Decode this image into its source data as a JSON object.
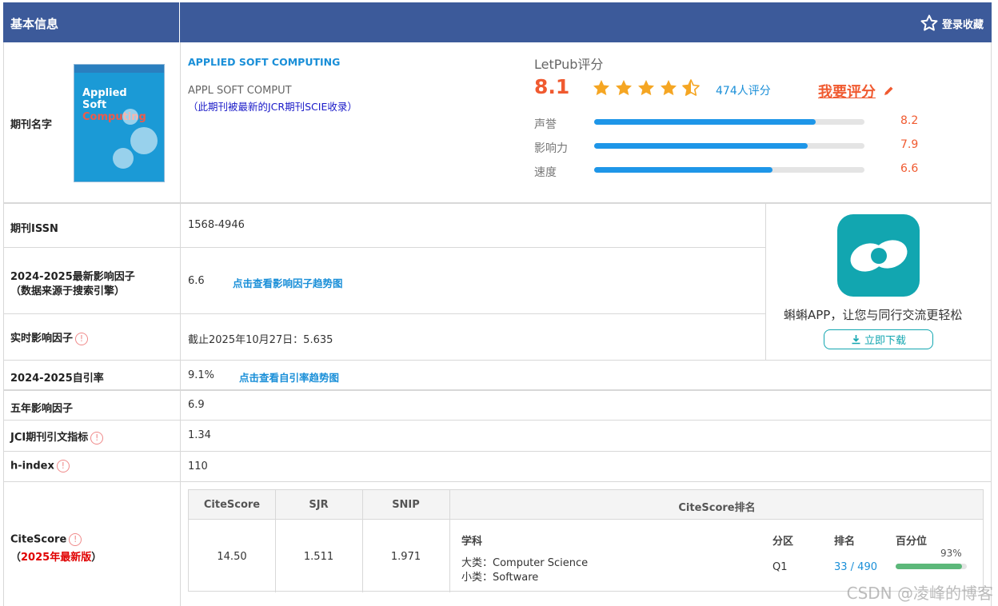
{
  "header": {
    "title": "基本信息",
    "favorite_label": "登录收藏"
  },
  "journal": {
    "name_label": "期刊名字",
    "full_name": "APPLIED SOFT COMPUTING",
    "abbr": "APPL SOFT COMPUT",
    "note": "（此期刊被最新的JCR期刊SCIE收录）",
    "cover_title_1": "Applied",
    "cover_title_2": "Soft",
    "cover_title_3": "Computing"
  },
  "letpub": {
    "title": "LetPub评分",
    "score": "8.1",
    "stars": 4.5,
    "reviews": "474人评分",
    "rate_link": "我要评分",
    "metrics": [
      {
        "label": "声誉",
        "value": "8.2",
        "fraction": 0.82
      },
      {
        "label": "影响力",
        "value": "7.9",
        "fraction": 0.79
      },
      {
        "label": "速度",
        "value": "6.6",
        "fraction": 0.66
      }
    ]
  },
  "rows": {
    "issn_label": "期刊ISSN",
    "issn_value": "1568-4946",
    "if_label_1": "2024-2025最新影响因子",
    "if_label_2": "（数据来源于搜索引擎）",
    "if_value": "6.6",
    "if_link": "点击查看影响因子趋势图",
    "rt_label": "实时影响因子",
    "rt_value": "截止2025年10月27日：5.635",
    "self_label": "2024-2025自引率",
    "self_value": "9.1%",
    "self_link": "点击查看自引率趋势图",
    "five_label": "五年影响因子",
    "five_value": "6.9",
    "jci_label": "JCI期刊引文指标",
    "jci_value": "1.34",
    "h_label": "h-index",
    "h_value": "110",
    "cs_label": "CiteScore",
    "cs_label_2_pre": "（",
    "cs_label_2_red": "2025年最新版",
    "cs_label_2_post": "）"
  },
  "app": {
    "slogan": "蝌蝌APP，让您与同行交流更轻松",
    "download": "立即下载"
  },
  "citescore": {
    "headers": [
      "CiteScore",
      "SJR",
      "SNIP",
      "CiteScore排名"
    ],
    "citescore": "14.50",
    "sjr": "1.511",
    "snip": "1.971",
    "subject_header": "学科",
    "zone_header": "分区",
    "rank_header": "排名",
    "pct_header": "百分位",
    "major": "大类：Computer Science",
    "minor": "小类：Software",
    "zone": "Q1",
    "rank": "33 / 490",
    "pct": "93%",
    "pct_fraction": 0.93
  },
  "watermark": "CSDN @凌峰的博客",
  "colors": {
    "header": "#3c5a9a",
    "accent": "#1e96e8",
    "score": "#f05a30",
    "app": "#12a6b0",
    "star": "#f5a623"
  }
}
